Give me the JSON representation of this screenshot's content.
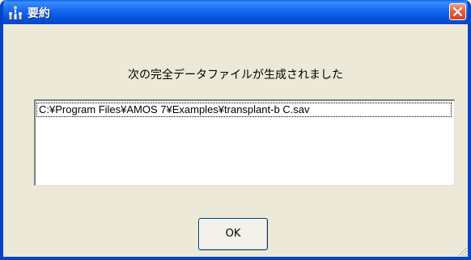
{
  "window": {
    "title": "要約",
    "title_icon": "amos-app-icon",
    "close_icon": "close-icon"
  },
  "dialog": {
    "message": "次の完全データファイルが生成されました",
    "files": [
      "C:¥Program Files¥AMOS 7¥Examples¥transplant-b C.sav"
    ],
    "ok_label": "OK"
  },
  "colors": {
    "titlebar": "#0842c6",
    "close_button": "#d5421c",
    "dialog_background": "#ece9d8"
  }
}
